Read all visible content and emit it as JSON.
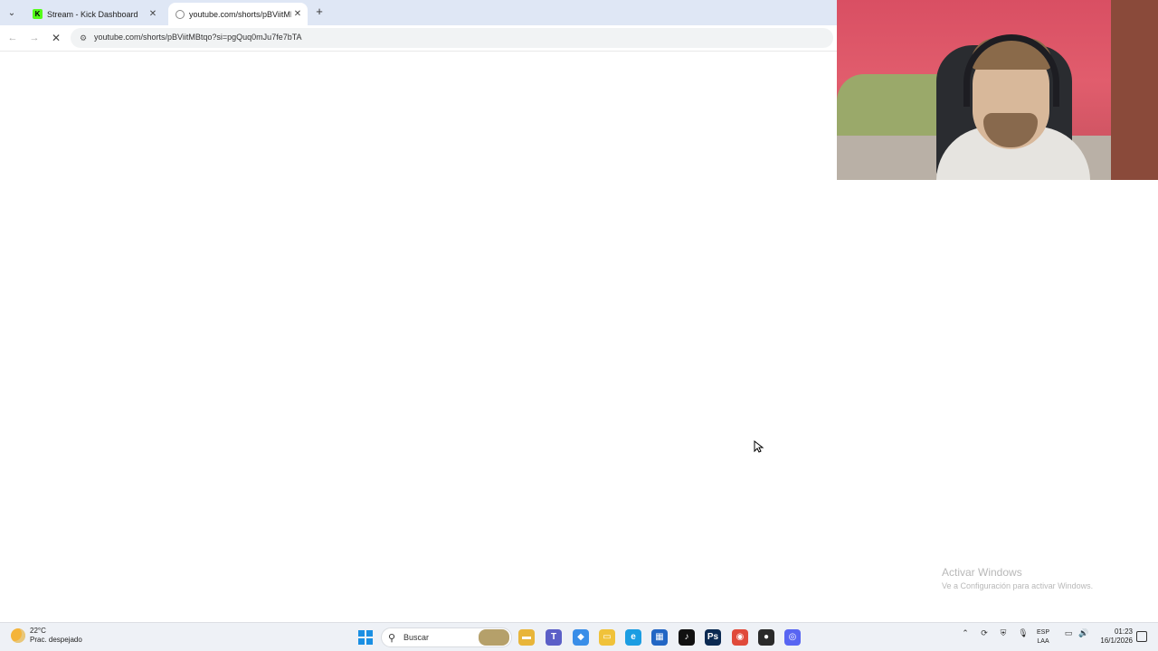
{
  "browser": {
    "tabs": [
      {
        "title": "Stream - Kick Dashboard",
        "favicon": "kick-icon"
      },
      {
        "title": "youtube.com/shorts/pBViitMBt",
        "favicon": "loading-icon"
      }
    ],
    "tab_menu_glyph": "⌄",
    "close_glyph": "✕",
    "new_tab_glyph": "+",
    "back_glyph": "←",
    "forward_glyph": "→",
    "stop_glyph": "✕",
    "url": "youtube.com/shorts/pBViitMBtqo?si=pgQuq0mJu7fe7bTA"
  },
  "watermark": {
    "line1": "Activar Windows",
    "line2": "Ve a Configuración para activar Windows."
  },
  "taskbar": {
    "weather_temp": "22°C",
    "weather_desc": "Prac. despejado",
    "search_label": "Buscar",
    "search_glyph": "⚲",
    "lang_line1": "ESP",
    "lang_line2": "LAA",
    "time": "01:23",
    "date": "16/1/2026",
    "apps": [
      {
        "name": "file-explorer-icon",
        "color": "#e8b53a",
        "glyph": "▬"
      },
      {
        "name": "teams-icon",
        "color": "#5b5fc7",
        "glyph": "T"
      },
      {
        "name": "copilot-icon",
        "color": "#3a8ee8",
        "glyph": "◆"
      },
      {
        "name": "folder-icon",
        "color": "#f0c23a",
        "glyph": "▭"
      },
      {
        "name": "edge-icon",
        "color": "#1b9de2",
        "glyph": "e"
      },
      {
        "name": "store-icon",
        "color": "#2266c4",
        "glyph": "▦"
      },
      {
        "name": "tiktok-icon",
        "color": "#111111",
        "glyph": "♪"
      },
      {
        "name": "photoshop-icon",
        "color": "#0b2a52",
        "glyph": "Ps"
      },
      {
        "name": "chrome-icon",
        "color": "#e04a3a",
        "glyph": "◉"
      },
      {
        "name": "obs-icon",
        "color": "#2a2a2a",
        "glyph": "●"
      },
      {
        "name": "discord-icon",
        "color": "#5865f2",
        "glyph": "◎"
      }
    ],
    "tray": [
      {
        "name": "show-hidden-icons",
        "glyph": "⌃"
      },
      {
        "name": "sync-icon",
        "glyph": "⟳"
      },
      {
        "name": "network-shield-icon",
        "glyph": "⛨"
      },
      {
        "name": "microphone-icon",
        "glyph": "🎙"
      },
      {
        "name": "display-icon",
        "glyph": "▭"
      },
      {
        "name": "volume-icon",
        "glyph": "🔊"
      }
    ]
  }
}
